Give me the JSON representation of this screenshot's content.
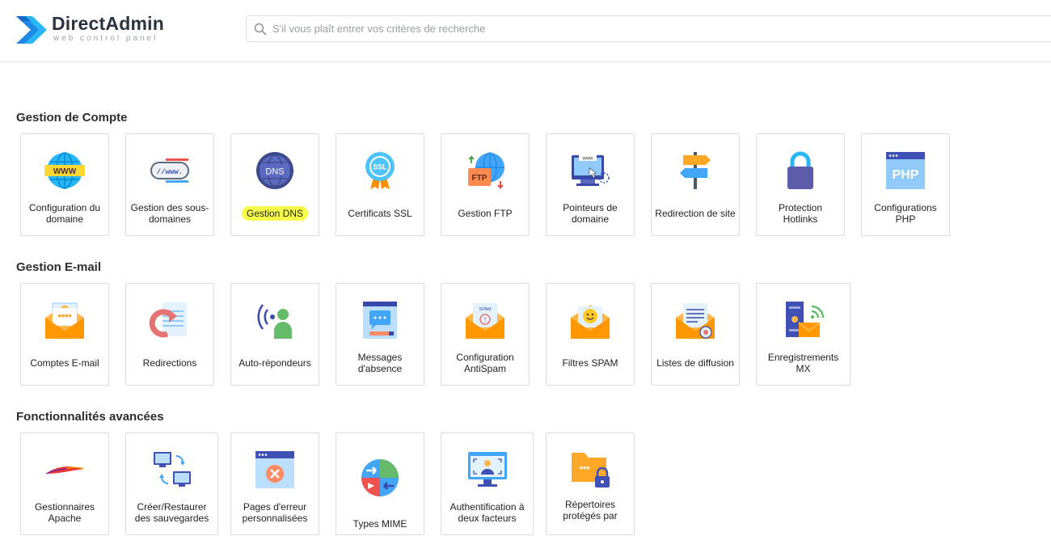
{
  "brand": {
    "title": "DirectAdmin",
    "subtitle": "web control panel"
  },
  "search": {
    "placeholder": "S'il vous plaît entrer vos critères de recherche"
  },
  "sections": {
    "account": {
      "title": "Gestion de Compte",
      "items": [
        {
          "label": "Configuration du domaine",
          "icon": "www-globe-icon"
        },
        {
          "label": "Gestion des sous-domaines",
          "icon": "subdomain-icon"
        },
        {
          "label": "Gestion DNS",
          "icon": "dns-globe-icon"
        },
        {
          "label": "Certificats SSL",
          "icon": "ssl-badge-icon"
        },
        {
          "label": "Gestion FTP",
          "icon": "ftp-icon"
        },
        {
          "label": "Pointeurs de domaine",
          "icon": "domain-pointer-icon"
        },
        {
          "label": "Redirection de site",
          "icon": "signpost-icon"
        },
        {
          "label": "Protection Hotlinks",
          "icon": "padlock-icon"
        },
        {
          "label": "Configurations PHP",
          "icon": "php-icon"
        }
      ]
    },
    "email": {
      "title": "Gestion E-mail",
      "items": [
        {
          "label": "Comptes E-mail",
          "icon": "email-account-icon"
        },
        {
          "label": "Redirections",
          "icon": "forward-icon"
        },
        {
          "label": "Auto-répondeurs",
          "icon": "autoresponder-icon"
        },
        {
          "label": "Messages d'absence",
          "icon": "vacation-message-icon"
        },
        {
          "label": "Configuration AntiSpam",
          "icon": "antispam-icon"
        },
        {
          "label": "Filtres SPAM",
          "icon": "spam-filter-icon"
        },
        {
          "label": "Listes de diffusion",
          "icon": "mailing-list-icon"
        },
        {
          "label": "Enregistrements MX",
          "icon": "mx-records-icon"
        }
      ]
    },
    "advanced": {
      "title": "Fonctionnalités avancées",
      "items": [
        {
          "label": "Gestionnaires Apache",
          "icon": "apache-feather-icon"
        },
        {
          "label": "Créer/Restaurer des sauvegardes",
          "icon": "backup-icon"
        },
        {
          "label": "Pages d'erreur personnalisées",
          "icon": "error-page-icon"
        },
        {
          "label": "Types MIME",
          "icon": "mime-types-icon"
        },
        {
          "label": "Authentification à deux facteurs",
          "icon": "two-factor-icon"
        },
        {
          "label": "Répertoires protégés par",
          "icon": "protected-folder-icon"
        }
      ]
    }
  },
  "highlight_color": "#f8ff4a"
}
